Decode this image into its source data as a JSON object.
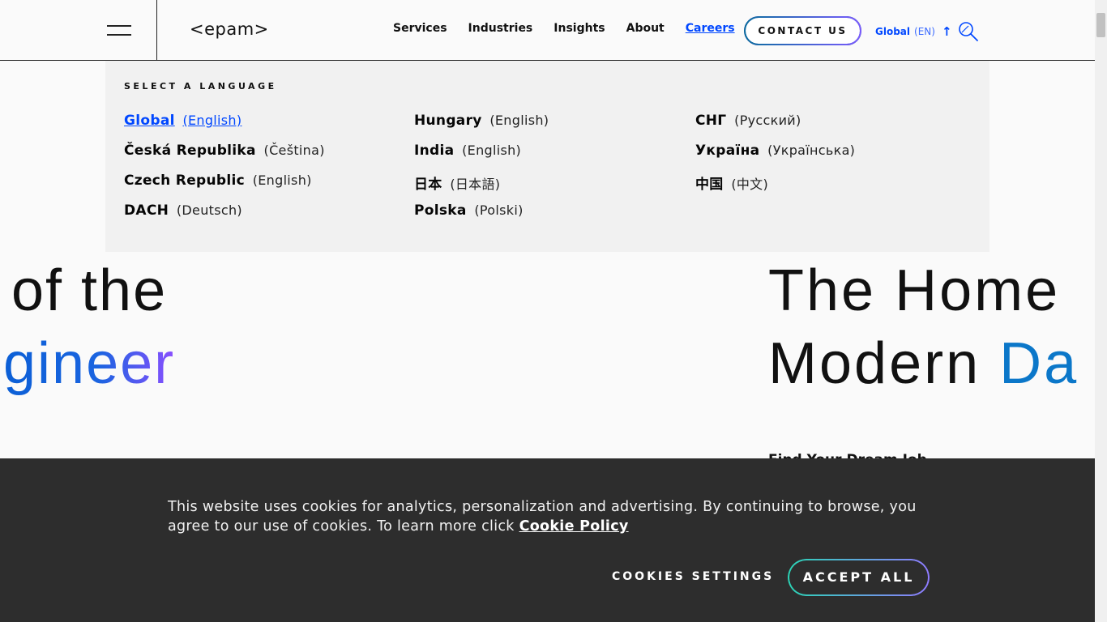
{
  "header": {
    "logo": "<epam>",
    "nav": [
      "Services",
      "Industries",
      "Insights",
      "About",
      "Careers"
    ],
    "contact_label": "CONTACT US",
    "lang_global": "Global",
    "lang_code": "(EN)"
  },
  "language_panel": {
    "title": "SELECT A LANGUAGE",
    "columns": [
      [
        {
          "country": "Global",
          "language": "(English)"
        },
        {
          "country": "Česká Republika",
          "language": "(Čeština)"
        },
        {
          "country": "Czech Republic",
          "language": "(English)"
        },
        {
          "country": "DACH",
          "language": "(Deutsch)"
        }
      ],
      [
        {
          "country": "Hungary",
          "language": "(English)"
        },
        {
          "country": "India",
          "language": "(English)"
        },
        {
          "country": "日本",
          "language": "(日本語)"
        },
        {
          "country": "Polska",
          "language": "(Polski)"
        }
      ],
      [
        {
          "country": "СНГ",
          "language": "(Русский)"
        },
        {
          "country": "Україна",
          "language": "(Українська)"
        },
        {
          "country": "中国",
          "language": "(中文)"
        }
      ]
    ]
  },
  "hero": {
    "left_line1": "of the",
    "left_line2": "gineer",
    "right_line1": "The Home",
    "right_line2_plain": "Modern ",
    "right_line2_accent": "Da",
    "peek_text": "Find Your Dream Job"
  },
  "cookie": {
    "text": "This website uses cookies for analytics, personalization and advertising. By continuing to browse, you agree to our use of cookies. To learn more click ",
    "link": "Cookie Policy",
    "settings_label": "COOKIES SETTINGS",
    "accept_label": "ACCEPT ALL"
  },
  "colors": {
    "accent_blue": "#0047ff",
    "banner_bg": "#2d2d2d",
    "panel_bg": "#f1f1f1"
  }
}
